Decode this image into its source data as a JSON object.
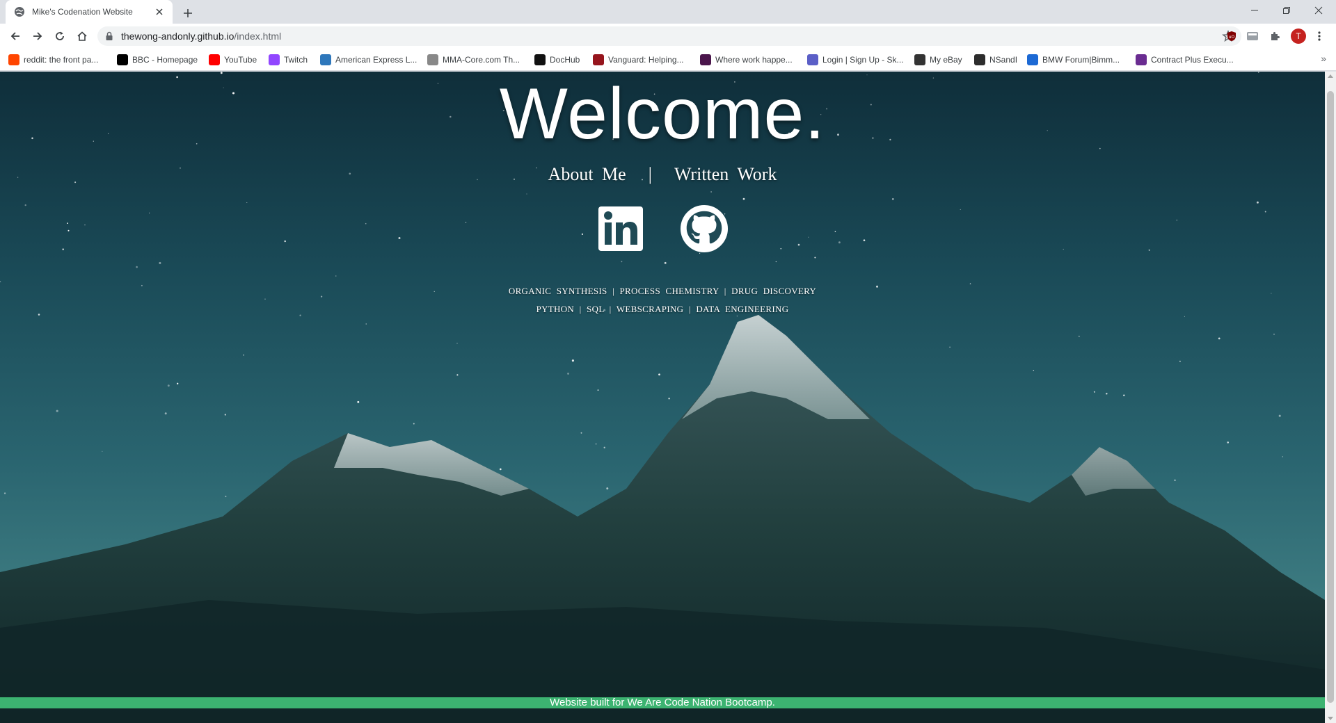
{
  "browser": {
    "tab": {
      "title": "Mike's Codenation Website",
      "favicon": "globe-icon"
    },
    "address_bar": {
      "host": "thewong-andonly.github.io",
      "path": "/index.html"
    },
    "profile_initial": "T",
    "bookmarks": [
      {
        "label": "reddit: the front pa...",
        "icon": "reddit-icon",
        "color": "#ff4500"
      },
      {
        "label": "BBC - Homepage",
        "icon": "bbc-icon",
        "color": "#000000"
      },
      {
        "label": "YouTube",
        "icon": "youtube-icon",
        "color": "#ff0000"
      },
      {
        "label": "Twitch",
        "icon": "twitch-icon",
        "color": "#9146ff"
      },
      {
        "label": "American Express L...",
        "icon": "amex-icon",
        "color": "#2e77bb"
      },
      {
        "label": "MMA-Core.com Th...",
        "icon": "mma-core-icon",
        "color": "#888888"
      },
      {
        "label": "DocHub",
        "icon": "dochub-icon",
        "color": "#111111"
      },
      {
        "label": "Vanguard: Helping...",
        "icon": "vanguard-icon",
        "color": "#96151d"
      },
      {
        "label": "Where work happe...",
        "icon": "slack-icon",
        "color": "#4a154b"
      },
      {
        "label": "Login | Sign Up - Sk...",
        "icon": "skype-icon",
        "color": "#5b5fc7"
      },
      {
        "label": "My eBay",
        "icon": "ebay-icon",
        "color": "#333333"
      },
      {
        "label": "NSandI",
        "icon": "nsandi-icon",
        "color": "#2d2d2d"
      },
      {
        "label": "BMW Forum|Bimm...",
        "icon": "bimmerpost-icon",
        "color": "#1c69d4"
      },
      {
        "label": "Contract Plus Execu...",
        "icon": "contract-plus-icon",
        "color": "#6a2c91"
      }
    ]
  },
  "page": {
    "title": "Welcome.",
    "nav": [
      {
        "label": "About Me"
      },
      {
        "label": "Written Work"
      }
    ],
    "nav_separator": "|",
    "social": [
      {
        "name": "linkedin-icon"
      },
      {
        "name": "github-icon"
      }
    ],
    "skills_line1": "ORGANIC SYNTHESIS | PROCESS CHEMISTRY | DRUG DISCOVERY",
    "skills_line2": "PYTHON | SQL | WEBSCRAPING | DATA ENGINEERING",
    "footer": "Website built for We Are Code Nation Bootcamp."
  },
  "colors": {
    "footer_green": "#3cb371",
    "sky_top": "#0f2e3a",
    "sky_bottom": "#4e8a8c"
  }
}
